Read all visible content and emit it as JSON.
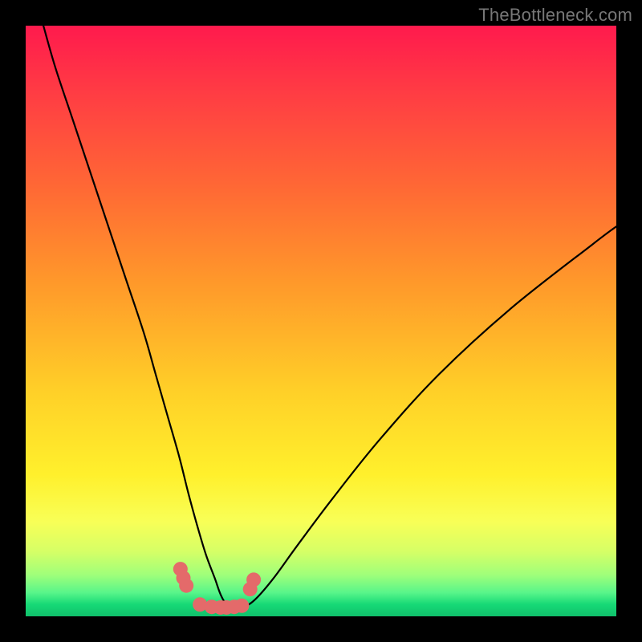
{
  "watermark": "TheBottleneck.com",
  "chart_data": {
    "type": "line",
    "title": "",
    "xlabel": "",
    "ylabel": "",
    "xlim": [
      0,
      100
    ],
    "ylim": [
      0,
      100
    ],
    "series": [
      {
        "name": "bottleneck-curve",
        "x": [
          3,
          5,
          8,
          11,
          14,
          17,
          20,
          22,
          24,
          26,
          27.5,
          29,
          30.5,
          32,
          33,
          34,
          35.5,
          37,
          39,
          42,
          46,
          52,
          60,
          70,
          82,
          96,
          100
        ],
        "values": [
          100,
          93,
          84,
          75,
          66,
          57,
          48,
          41,
          34,
          27,
          21,
          15.5,
          10.5,
          6.5,
          3.7,
          2.1,
          1.4,
          1.6,
          3.0,
          6.5,
          12,
          20,
          30,
          41,
          52,
          63,
          66
        ]
      },
      {
        "name": "dot-markers",
        "x": [
          26.2,
          26.7,
          27.2,
          29.5,
          31.5,
          33.0,
          34.0,
          35.3,
          36.6,
          38.0,
          38.6
        ],
        "values": [
          8.0,
          6.5,
          5.2,
          2.0,
          1.6,
          1.5,
          1.5,
          1.6,
          1.8,
          4.6,
          6.2
        ]
      }
    ],
    "colors": {
      "curve": "#000000",
      "markers": "#e46a6a"
    }
  }
}
